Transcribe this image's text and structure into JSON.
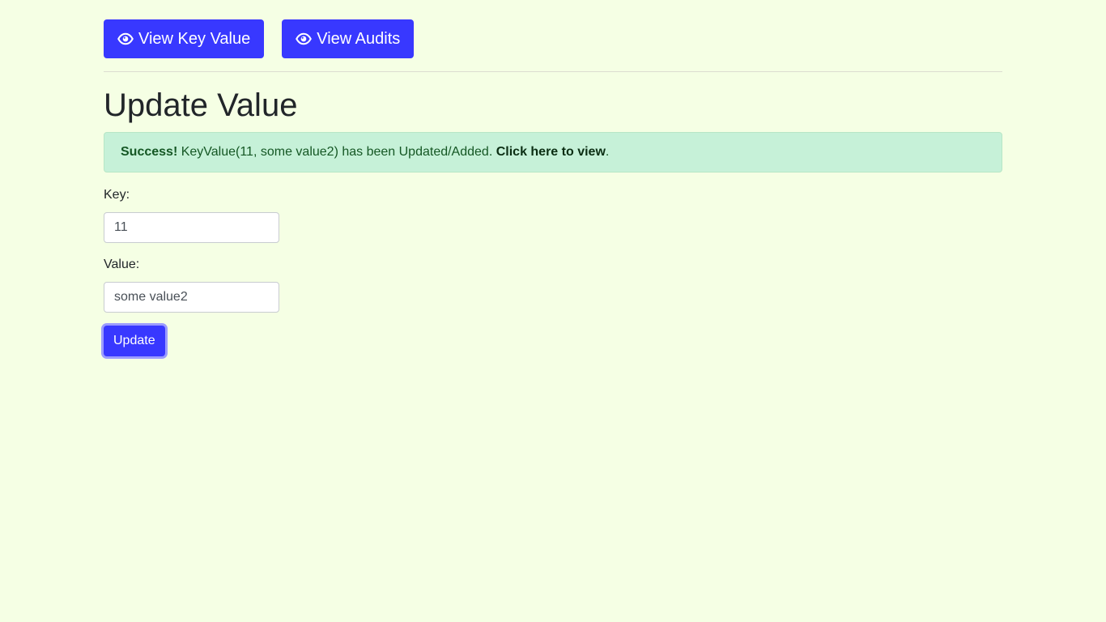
{
  "nav": {
    "view_key_value_label": "View Key Value",
    "view_audits_label": "View Audits",
    "icon": "eye-icon",
    "button_color": "#3838ff"
  },
  "page": {
    "title": "Update Value",
    "background_color": "#f5ffe4"
  },
  "alert": {
    "prefix": "Success!",
    "message": " KeyValue(11, some value2) has been Updated/Added. ",
    "link_label": "Click here to view",
    "suffix": ".",
    "background_color": "#c6f1d8"
  },
  "form": {
    "key_label": "Key:",
    "key_value": "11",
    "value_label": "Value:",
    "value_value": "some value2",
    "submit_label": "Update"
  }
}
